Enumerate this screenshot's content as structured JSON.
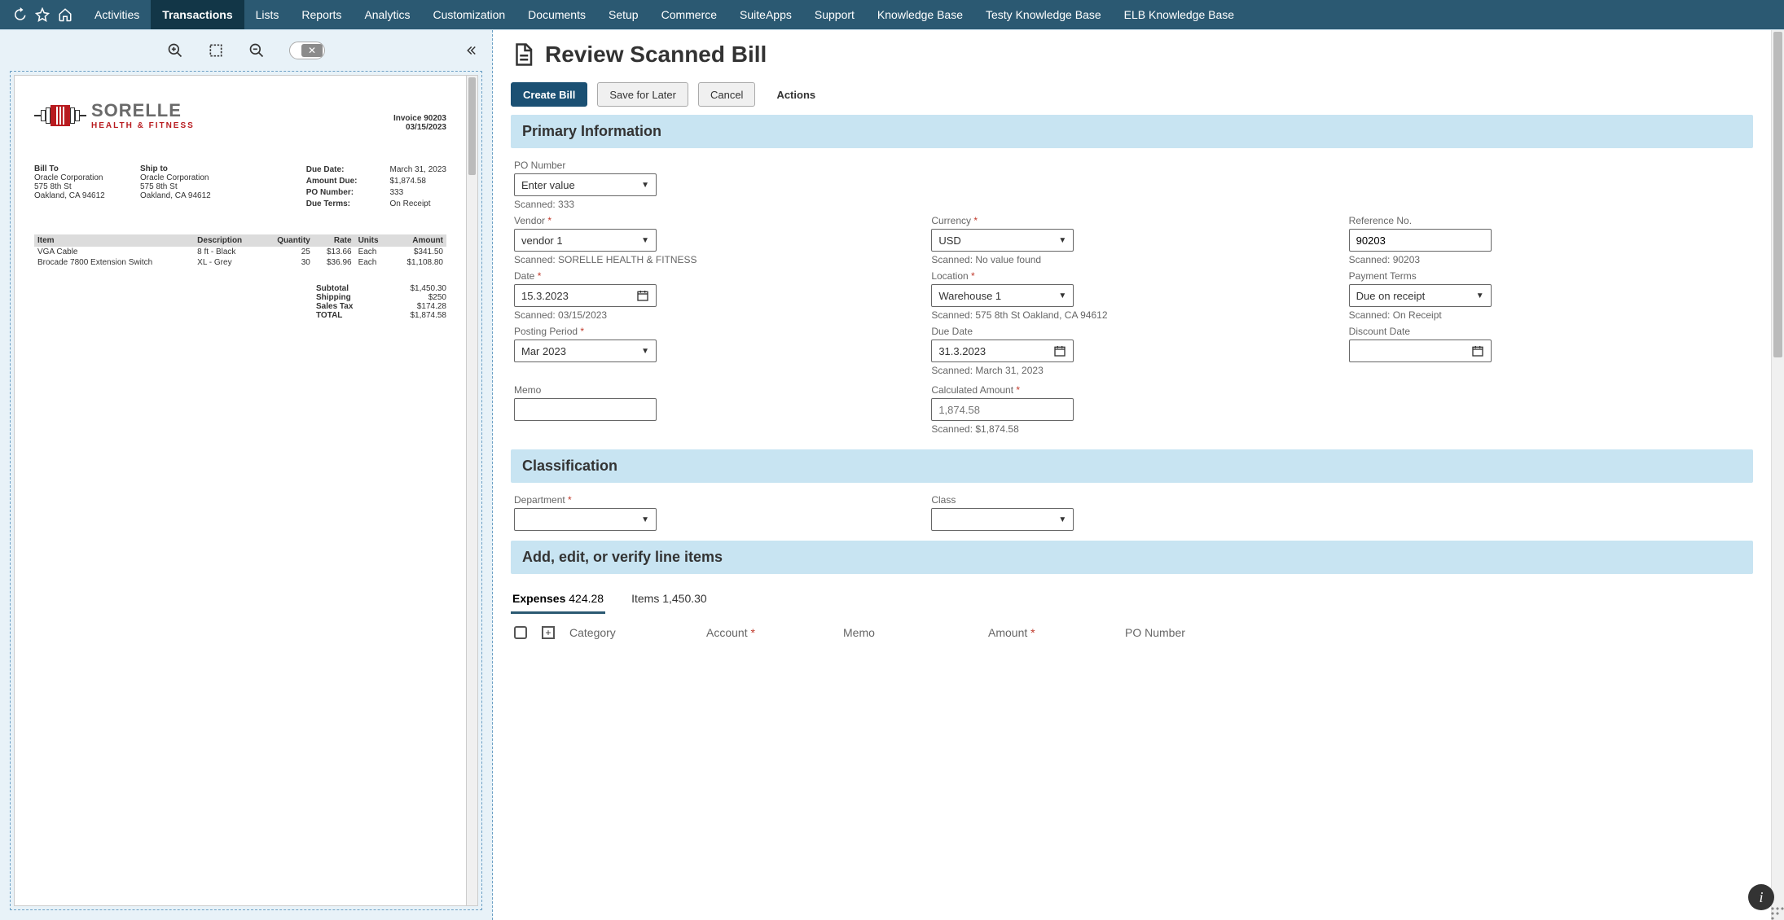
{
  "nav": {
    "items": [
      {
        "label": "Activities"
      },
      {
        "label": "Transactions",
        "active": true
      },
      {
        "label": "Lists"
      },
      {
        "label": "Reports"
      },
      {
        "label": "Analytics"
      },
      {
        "label": "Customization"
      },
      {
        "label": "Documents"
      },
      {
        "label": "Setup"
      },
      {
        "label": "Commerce"
      },
      {
        "label": "SuiteApps"
      },
      {
        "label": "Support"
      },
      {
        "label": "Knowledge Base"
      },
      {
        "label": "Testy Knowledge Base"
      },
      {
        "label": "ELB Knowledge Base"
      }
    ]
  },
  "page": {
    "title": "Review Scanned Bill",
    "buttons": {
      "create": "Create Bill",
      "save": "Save for Later",
      "cancel": "Cancel",
      "actions": "Actions"
    }
  },
  "sections": {
    "primary": "Primary Information",
    "classification": "Classification",
    "lines": "Add, edit, or verify line items"
  },
  "fields": {
    "po_number": {
      "label": "PO Number",
      "value": "Enter value",
      "scanned": "Scanned: 333"
    },
    "vendor": {
      "label": "Vendor",
      "value": "vendor 1",
      "scanned": "Scanned: SORELLE HEALTH & FITNESS"
    },
    "currency": {
      "label": "Currency",
      "value": "USD",
      "scanned": "Scanned: No value found"
    },
    "refno": {
      "label": "Reference No.",
      "value": "90203",
      "scanned": "Scanned: 90203"
    },
    "date": {
      "label": "Date",
      "value": "15.3.2023",
      "scanned": "Scanned: 03/15/2023"
    },
    "location": {
      "label": "Location",
      "value": "Warehouse 1",
      "scanned": "Scanned: 575 8th St Oakland, CA 94612"
    },
    "terms": {
      "label": "Payment Terms",
      "value": "Due on receipt",
      "scanned": "Scanned: On Receipt"
    },
    "posting": {
      "label": "Posting Period",
      "value": "Mar 2023"
    },
    "due": {
      "label": "Due Date",
      "value": "31.3.2023",
      "scanned": "Scanned: March 31, 2023"
    },
    "discount": {
      "label": "Discount Date",
      "value": ""
    },
    "memo": {
      "label": "Memo",
      "value": ""
    },
    "calc": {
      "label": "Calculated Amount",
      "placeholder": "1,874.58",
      "scanned": "Scanned: $1,874.58"
    },
    "dept": {
      "label": "Department",
      "value": ""
    },
    "class": {
      "label": "Class",
      "value": ""
    }
  },
  "tabs": {
    "expenses": {
      "label": "Expenses",
      "amount": "424.28"
    },
    "items": {
      "label": "Items",
      "amount": "1,450.30"
    }
  },
  "grid": {
    "columns": [
      "Category",
      "Account",
      "Memo",
      "Amount",
      "PO Number"
    ]
  },
  "invoice": {
    "brand_name": "SORELLE",
    "brand_tag": "HEALTH & FITNESS",
    "invoice_no": "Invoice 90203",
    "invoice_date": "03/15/2023",
    "bill_to": {
      "h": "Bill To",
      "l1": "Oracle Corporation",
      "l2": "575 8th St",
      "l3": "Oakland, CA 94612"
    },
    "ship_to": {
      "h": "Ship to",
      "l1": "Oracle Corporation",
      "l2": "575 8th St",
      "l3": "Oakland, CA 94612"
    },
    "meta_labels": {
      "due": "Due Date:",
      "amount": "Amount Due:",
      "po": "PO Number:",
      "terms": "Due Terms:"
    },
    "meta_values": {
      "due": "March 31, 2023",
      "amount": "$1,874.58",
      "po": "333",
      "terms": "On Receipt"
    },
    "cols": {
      "item": "Item",
      "desc": "Description",
      "qty": "Quantity",
      "rate": "Rate",
      "units": "Units",
      "amount": "Amount"
    },
    "lines": [
      {
        "item": "VGA Cable",
        "desc": "8 ft - Black",
        "qty": "25",
        "rate": "$13.66",
        "units": "Each",
        "amount": "$341.50"
      },
      {
        "item": "Brocade 7800 Extension Switch",
        "desc": "XL - Grey",
        "qty": "30",
        "rate": "$36.96",
        "units": "Each",
        "amount": "$1,108.80"
      }
    ],
    "subtotals": {
      "subtotal_l": "Subtotal",
      "subtotal_v": "$1,450.30",
      "shipping_l": "Shipping",
      "shipping_v": "$250",
      "tax_l": "Sales Tax",
      "tax_v": "$174.28",
      "total_l": "TOTAL",
      "total_v": "$1,874.58"
    }
  }
}
